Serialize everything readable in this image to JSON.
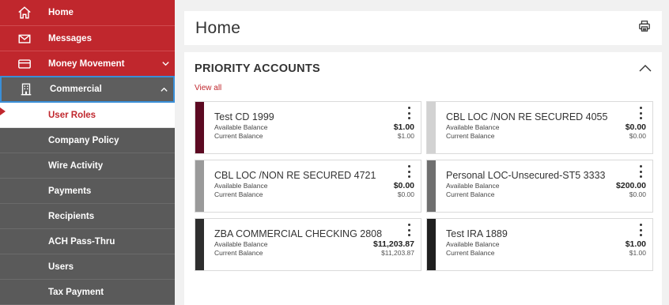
{
  "sidebar": {
    "top_items": [
      {
        "label": "Home",
        "icon": "home-icon"
      },
      {
        "label": "Messages",
        "icon": "envelope-icon"
      },
      {
        "label": "Money Movement",
        "icon": "card-icon"
      }
    ],
    "commercial": {
      "label": "Commercial",
      "icon": "building-icon"
    },
    "sub_items": [
      {
        "label": "User Roles"
      },
      {
        "label": "Company Policy"
      },
      {
        "label": "Wire Activity"
      },
      {
        "label": "Payments"
      },
      {
        "label": "Recipients"
      },
      {
        "label": "ACH Pass-Thru"
      },
      {
        "label": "Users"
      },
      {
        "label": "Tax Payment"
      }
    ]
  },
  "header": {
    "title": "Home"
  },
  "accounts": {
    "title": "PRIORITY ACCOUNTS",
    "view_all": "View all",
    "available_label": "Available Balance",
    "current_label": "Current Balance",
    "tiles": [
      {
        "name": "Test CD 1999",
        "available": "$1.00",
        "current": "$1.00",
        "color": "#5c0a22"
      },
      {
        "name": "CBL LOC /NON RE SECURED 4055",
        "available": "$0.00",
        "current": "$0.00",
        "color": "#d2d2d2"
      },
      {
        "name": "CBL LOC /NON RE SECURED 4721",
        "available": "$0.00",
        "current": "$0.00",
        "color": "#9a9a9a"
      },
      {
        "name": "Personal LOC-Unsecured-ST5 3333",
        "available": "$200.00",
        "current": "$0.00",
        "color": "#6f6f6f"
      },
      {
        "name": "ZBA COMMERCIAL CHECKING 2808",
        "available": "$11,203.87",
        "current": "$11,203.87",
        "color": "#2e2e2e"
      },
      {
        "name": "Test IRA 1889",
        "available": "$1.00",
        "current": "$1.00",
        "color": "#1f1f1f"
      }
    ]
  },
  "colors": {
    "brand_red": "#c0272d",
    "sidebar_gray": "#5a5a5a",
    "focus_blue": "#3a8fd8"
  }
}
